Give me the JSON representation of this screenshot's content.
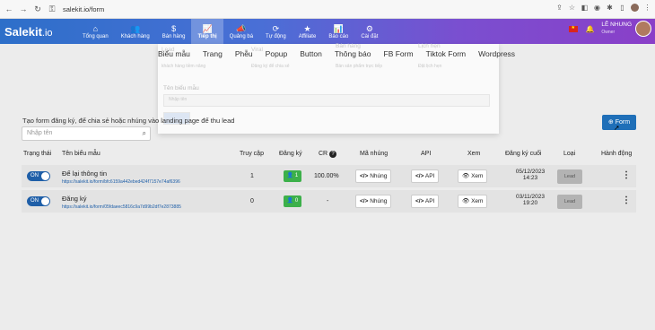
{
  "browser": {
    "url": "salekit.io/form"
  },
  "app": {
    "logo": "Salekit",
    "logo_suffix": ".io",
    "menu": [
      {
        "icon": "⌂",
        "label": "Tổng quan"
      },
      {
        "icon": "👥",
        "label": "Khách hàng"
      },
      {
        "icon": "$",
        "label": "Bán hàng"
      },
      {
        "icon": "📈",
        "label": "Tiếp thị"
      },
      {
        "icon": "📣",
        "label": "Quảng bá"
      },
      {
        "icon": "⟳",
        "label": "Tự động"
      },
      {
        "icon": "★",
        "label": "Affiliate"
      },
      {
        "icon": "📊",
        "label": "Báo cáo"
      },
      {
        "icon": "⚙",
        "label": "Cài đặt"
      }
    ],
    "user": {
      "name": "LÊ NHUNG",
      "role": "Owner"
    }
  },
  "subnav": [
    "Biểu mẫu",
    "Trang",
    "Phễu",
    "Popup",
    "Button",
    "Thông báo",
    "FB Form",
    "Tiktok Form",
    "Wordpress"
  ],
  "ghost_menu": {
    "col1": [
      "Lead",
      "khách hàng tiềm năng"
    ],
    "col2": [
      "Viral",
      "Đăng ký để chia sẻ"
    ],
    "col3": [
      "Bán hàng",
      "Bán sản phẩm trực tiếp"
    ],
    "col4": [
      "Lịch hẹn",
      "Đặt lịch hẹn"
    ],
    "field_label": "Tên biểu mẫu",
    "field_placeholder": "Nhập tên"
  },
  "description": "Tạo form đăng ký, để chia sẻ hoặc nhúng vào landing page để thu lead",
  "search": {
    "placeholder": "Nhập tên"
  },
  "add_button": "Form",
  "columns": [
    "Trạng thái",
    "Tên biểu mẫu",
    "Truy cập",
    "Đăng ký",
    "CR",
    "Mã nhúng",
    "API",
    "Xem",
    "Đăng ký cuối",
    "Loại",
    "Hành động"
  ],
  "rows": [
    {
      "status": "ON",
      "name": "Để lại thông tin",
      "url": "https://salekit.io/form/bfc6159a442ebed424f7157e74af6396",
      "visits": "1",
      "signups": "1",
      "cr": "100.00%",
      "embed": "Nhúng",
      "api": "API",
      "view": "Xem",
      "last_date": "05/12/2023",
      "last_time": "14:23",
      "type": "Lead"
    },
    {
      "status": "ON",
      "name": "Đăng ký",
      "url": "https://salekit.io/form/05fdaeec5816c9a7d99b2df7e2873885",
      "visits": "0",
      "signups": "0",
      "cr": "-",
      "embed": "Nhúng",
      "api": "API",
      "view": "Xem",
      "last_date": "03/11/2023",
      "last_time": "19:20",
      "type": "Lead"
    }
  ]
}
